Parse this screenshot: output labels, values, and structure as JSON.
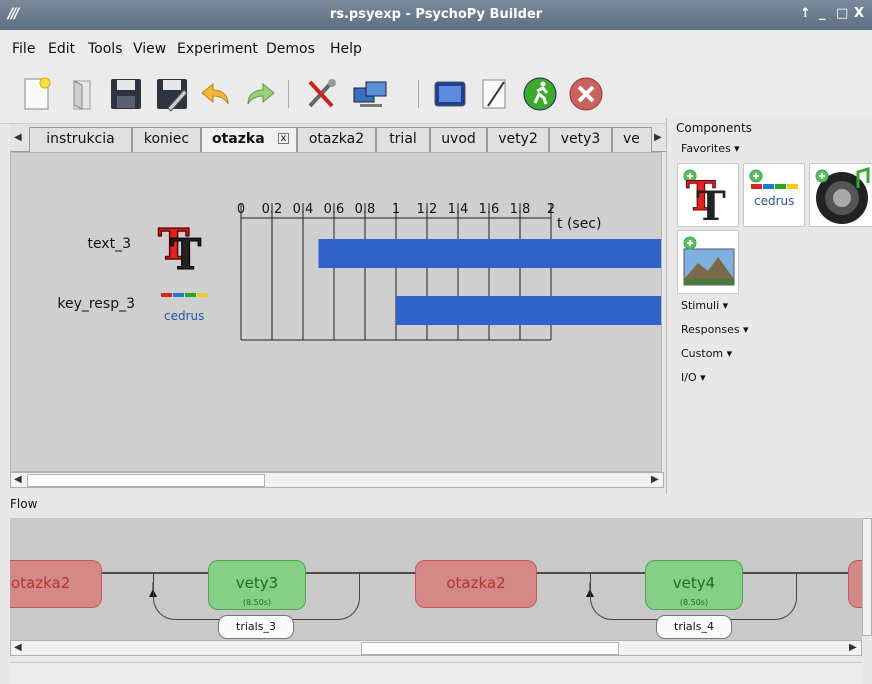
{
  "window": {
    "title": "rs.psyexp - PsychoPy Builder",
    "controls": [
      "↑",
      "_",
      "□",
      "X"
    ]
  },
  "menu": [
    {
      "label": "File"
    },
    {
      "label": "Edit"
    },
    {
      "label": "Tools"
    },
    {
      "label": "View"
    },
    {
      "label": "Experiment"
    },
    {
      "label": "Demos"
    },
    {
      "label": "Help"
    }
  ],
  "toolbar": {
    "buttons": [
      {
        "icon": "new-file-icon"
      },
      {
        "icon": "open-file-icon"
      },
      {
        "icon": "save-icon"
      },
      {
        "icon": "save-as-icon"
      },
      {
        "icon": "undo-icon"
      },
      {
        "icon": "redo-icon"
      },
      {
        "icon": "preferences-icon"
      },
      {
        "icon": "monitor-icon"
      },
      {
        "icon": "experiment-settings-icon"
      },
      {
        "icon": "compile-script-icon"
      },
      {
        "icon": "run-icon"
      },
      {
        "icon": "stop-icon"
      }
    ]
  },
  "routine_tabs": [
    {
      "label": "instrukcia"
    },
    {
      "label": "koniec"
    },
    {
      "label": "otazka",
      "active": true
    },
    {
      "label": "otazka2"
    },
    {
      "label": "trial"
    },
    {
      "label": "uvod"
    },
    {
      "label": "vety2"
    },
    {
      "label": "vety3"
    },
    {
      "label": "ve"
    }
  ],
  "timeline": {
    "tick_labels": [
      "0",
      "0.2",
      "0.4",
      "0.6",
      "0.8",
      "1",
      "1.2",
      "1.4",
      "1.6",
      "1.8",
      "2"
    ],
    "axis_label": "t (sec)",
    "components": [
      {
        "name": "text_3",
        "icon": "text-component-icon",
        "start": 0.5
      },
      {
        "name": "key_resp_3",
        "icon": "cedrus-component-icon",
        "start": 1.0
      }
    ],
    "bar_color": "#3162c9"
  },
  "components_panel": {
    "title": "Components",
    "categories": [
      {
        "label": "Favorites ▾"
      },
      {
        "label": "Stimuli ▾"
      },
      {
        "label": "Responses ▾"
      },
      {
        "label": "Custom ▾"
      },
      {
        "label": "I/O ▾"
      }
    ],
    "favorites": [
      {
        "icon": "text-component-icon"
      },
      {
        "icon": "cedrus-component-icon",
        "label": "cedrus"
      },
      {
        "icon": "sound-component-icon"
      },
      {
        "icon": "image-component-icon"
      }
    ]
  },
  "flow": {
    "label": "Flow",
    "routines": [
      {
        "name": "otazka2",
        "color": "red"
      },
      {
        "name": "vety3",
        "duration": "(8.50s)",
        "color": "green"
      },
      {
        "name": "otazka2",
        "color": "red"
      },
      {
        "name": "vety4",
        "duration": "(8.50s)",
        "color": "green"
      }
    ],
    "loops": [
      {
        "name": "trials_3"
      },
      {
        "name": "trials_4"
      }
    ]
  },
  "colors": {
    "routine_red": "#d48888",
    "routine_green": "#86cf86",
    "canvas_bg": "#cfcfcf"
  }
}
